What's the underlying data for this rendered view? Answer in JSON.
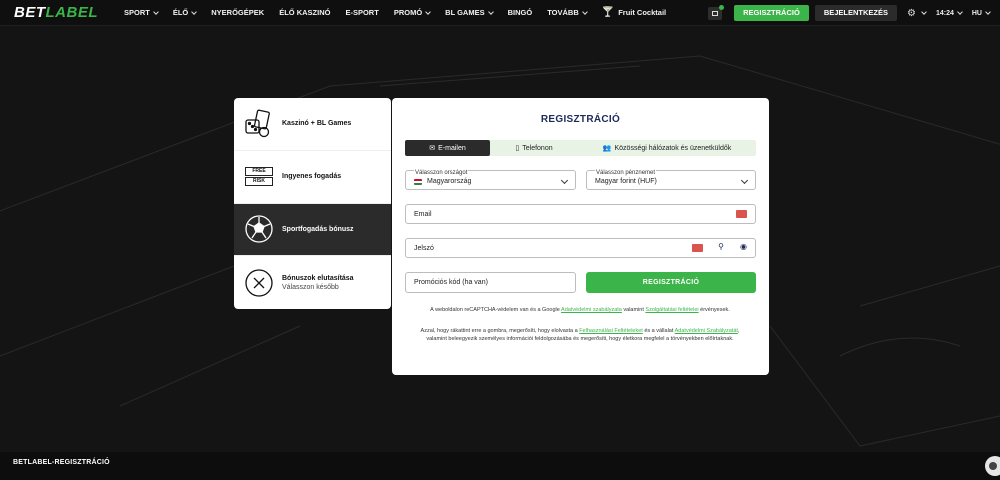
{
  "header": {
    "logo_part1": "BET",
    "logo_part2": "LABEL",
    "nav": [
      {
        "label": "SPORT",
        "dropdown": true
      },
      {
        "label": "ÉLŐ",
        "dropdown": true
      },
      {
        "label": "NYERŐGÉPEK",
        "dropdown": false
      },
      {
        "label": "ÉLŐ KASZINÓ",
        "dropdown": false
      },
      {
        "label": "E-SPORT",
        "dropdown": false
      },
      {
        "label": "PROMÓ",
        "dropdown": true
      },
      {
        "label": "BL GAMES",
        "dropdown": true
      },
      {
        "label": "BINGÓ",
        "dropdown": false
      },
      {
        "label": "TOVÁBB",
        "dropdown": true
      },
      {
        "label": "Fruit Cocktail",
        "dropdown": false
      }
    ],
    "register_label": "REGISZTRÁCIÓ",
    "login_label": "BEJELENTKEZÉS",
    "time": "14:24",
    "language": "HU"
  },
  "bonus_panel": {
    "items": [
      {
        "title": "Kaszinó + BL Games",
        "subtitle": ""
      },
      {
        "title": "Ingyenes fogadás",
        "subtitle": ""
      },
      {
        "title": "Sportfogadás bónusz",
        "subtitle": ""
      },
      {
        "title": "Bónuszok elutasítása",
        "subtitle": "Válasszon később"
      }
    ],
    "free_label": "FREE",
    "risk_label": "RISK"
  },
  "registration": {
    "title": "REGISZTRÁCIÓ",
    "tabs": [
      {
        "label": "E-mailen",
        "active": true
      },
      {
        "label": "Telefonon",
        "active": false
      },
      {
        "label": "Közösségi hálózatok és üzenetküldők",
        "active": false
      }
    ],
    "country_label": "Válasszon országot",
    "country_value": "Magyarország",
    "currency_label": "Válasszon pénznemet",
    "currency_value": "Magyar forint (HUF)",
    "email_placeholder": "Email",
    "password_placeholder": "Jelszó",
    "promo_placeholder": "Promóciós kód (ha van)",
    "submit_label": "REGISZTRÁCIÓ",
    "recaptcha_text_1": "A weboldalon reCAPTCHA-védelem van és a Google",
    "recaptcha_link_1": "Adatvédelmi szabályzata",
    "recaptcha_text_2": "valamint",
    "recaptcha_link_2": "Szolgáltatási feltételei",
    "recaptcha_text_3": "érvényesek.",
    "terms_text_1": "Azzal, hogy rákattint erre a gombra, megerősíti, hogy elolvasta a",
    "terms_link_1": "Felhasználási Feltételeket",
    "terms_text_2": "és a vállalat",
    "terms_link_2": "Adatvédelmi Szabályzatát",
    "terms_text_3": ", valamint beleegyezik személyes információi feldolgozásába és megerősíti, hogy életkora megfelel a törvényekben előírtaknak."
  },
  "footer": {
    "title": "BETLABEL-REGISZTRÁCIÓ"
  }
}
